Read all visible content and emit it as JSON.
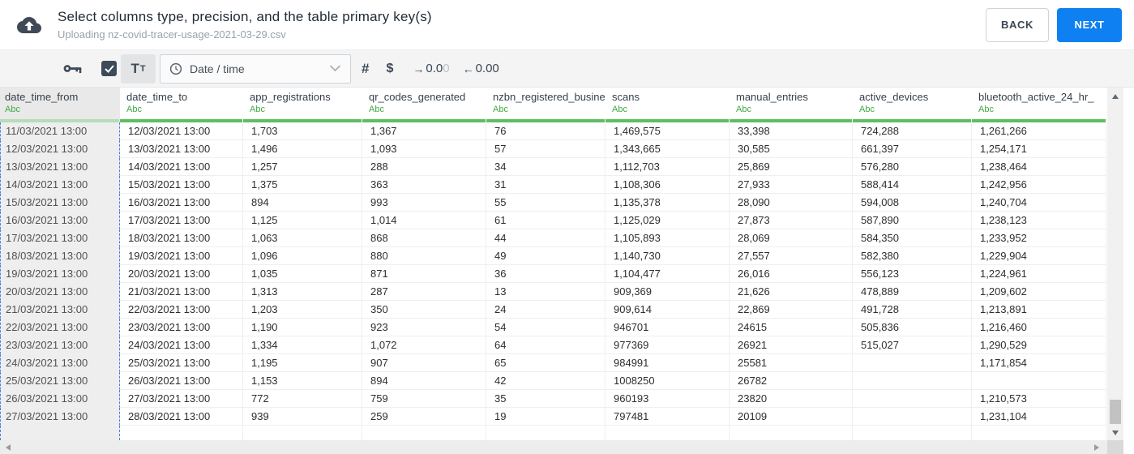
{
  "header": {
    "title": "Select columns type, precision, and the table primary key(s)",
    "subtitle": "Uploading nz-covid-tracer-usage-2021-03-29.csv",
    "back_label": "BACK",
    "next_label": "NEXT"
  },
  "toolbar": {
    "text_type_large": "T",
    "text_type_small": "T",
    "type_dropdown_value": "Date / time",
    "number_symbol": "#",
    "currency_symbol": "$",
    "decimal_right_arrow": "→",
    "decimal_right_dark": "0.0",
    "decimal_right_light": "0",
    "decimal_left_arrow": "←",
    "decimal_left_value": "0.00"
  },
  "table": {
    "columns": [
      {
        "name": "date_time_from",
        "type": "Abc",
        "selected": true
      },
      {
        "name": "date_time_to",
        "type": "Abc",
        "selected": false
      },
      {
        "name": "app_registrations",
        "type": "Abc",
        "selected": false
      },
      {
        "name": "qr_codes_generated",
        "type": "Abc",
        "selected": false
      },
      {
        "name": "nzbn_registered_busine",
        "type": "Abc",
        "selected": false
      },
      {
        "name": "scans",
        "type": "Abc",
        "selected": false
      },
      {
        "name": "manual_entries",
        "type": "Abc",
        "selected": false
      },
      {
        "name": "active_devices",
        "type": "Abc",
        "selected": false
      },
      {
        "name": "bluetooth_active_24_hr_",
        "type": "Abc",
        "selected": false
      }
    ],
    "rows": [
      [
        "11/03/2021 13:00",
        "12/03/2021 13:00",
        "1,703",
        "1,367",
        "76",
        "1,469,575",
        "33,398",
        "724,288",
        "1,261,266"
      ],
      [
        "12/03/2021 13:00",
        "13/03/2021 13:00",
        "1,496",
        "1,093",
        "57",
        "1,343,665",
        "30,585",
        "661,397",
        "1,254,171"
      ],
      [
        "13/03/2021 13:00",
        "14/03/2021 13:00",
        "1,257",
        "288",
        "34",
        "1,112,703",
        "25,869",
        "576,280",
        "1,238,464"
      ],
      [
        "14/03/2021 13:00",
        "15/03/2021 13:00",
        "1,375",
        "363",
        "31",
        "1,108,306",
        "27,933",
        "588,414",
        "1,242,956"
      ],
      [
        "15/03/2021 13:00",
        "16/03/2021 13:00",
        "894",
        "993",
        "55",
        "1,135,378",
        "28,090",
        "594,008",
        "1,240,704"
      ],
      [
        "16/03/2021 13:00",
        "17/03/2021 13:00",
        "1,125",
        "1,014",
        "61",
        "1,125,029",
        "27,873",
        "587,890",
        "1,238,123"
      ],
      [
        "17/03/2021 13:00",
        "18/03/2021 13:00",
        "1,063",
        "868",
        "44",
        "1,105,893",
        "28,069",
        "584,350",
        "1,233,952"
      ],
      [
        "18/03/2021 13:00",
        "19/03/2021 13:00",
        "1,096",
        "880",
        "49",
        "1,140,730",
        "27,557",
        "582,380",
        "1,229,904"
      ],
      [
        "19/03/2021 13:00",
        "20/03/2021 13:00",
        "1,035",
        "871",
        "36",
        "1,104,477",
        "26,016",
        "556,123",
        "1,224,961"
      ],
      [
        "20/03/2021 13:00",
        "21/03/2021 13:00",
        "1,313",
        "287",
        "13",
        "909,369",
        "21,626",
        "478,889",
        "1,209,602"
      ],
      [
        "21/03/2021 13:00",
        "22/03/2021 13:00",
        "1,203",
        "350",
        "24",
        "909,614",
        "22,869",
        "491,728",
        "1,213,891"
      ],
      [
        "22/03/2021 13:00",
        "23/03/2021 13:00",
        "1,190",
        "923",
        "54",
        "946701",
        "24615",
        "505,836",
        "1,216,460"
      ],
      [
        "23/03/2021 13:00",
        "24/03/2021 13:00",
        "1,334",
        "1,072",
        "64",
        "977369",
        "26921",
        "515,027",
        "1,290,529"
      ],
      [
        "24/03/2021 13:00",
        "25/03/2021 13:00",
        "1,195",
        "907",
        "65",
        "984991",
        "25581",
        "",
        "1,171,854"
      ],
      [
        "25/03/2021 13:00",
        "26/03/2021 13:00",
        "1,153",
        "894",
        "42",
        "1008250",
        "26782",
        "",
        ""
      ],
      [
        "26/03/2021 13:00",
        "27/03/2021 13:00",
        "772",
        "759",
        "35",
        "960193",
        "23820",
        "",
        "1,210,573"
      ],
      [
        "27/03/2021 13:00",
        "28/03/2021 13:00",
        "939",
        "259",
        "19",
        "797481",
        "20109",
        "",
        "1,231,104"
      ]
    ]
  },
  "colors": {
    "accent_blue": "#0e80f1",
    "type_green": "#3fa845",
    "header_bar_green": "#5fbe62",
    "selection_blue": "#4a80e8",
    "icon_slate": "#3d4a57"
  }
}
